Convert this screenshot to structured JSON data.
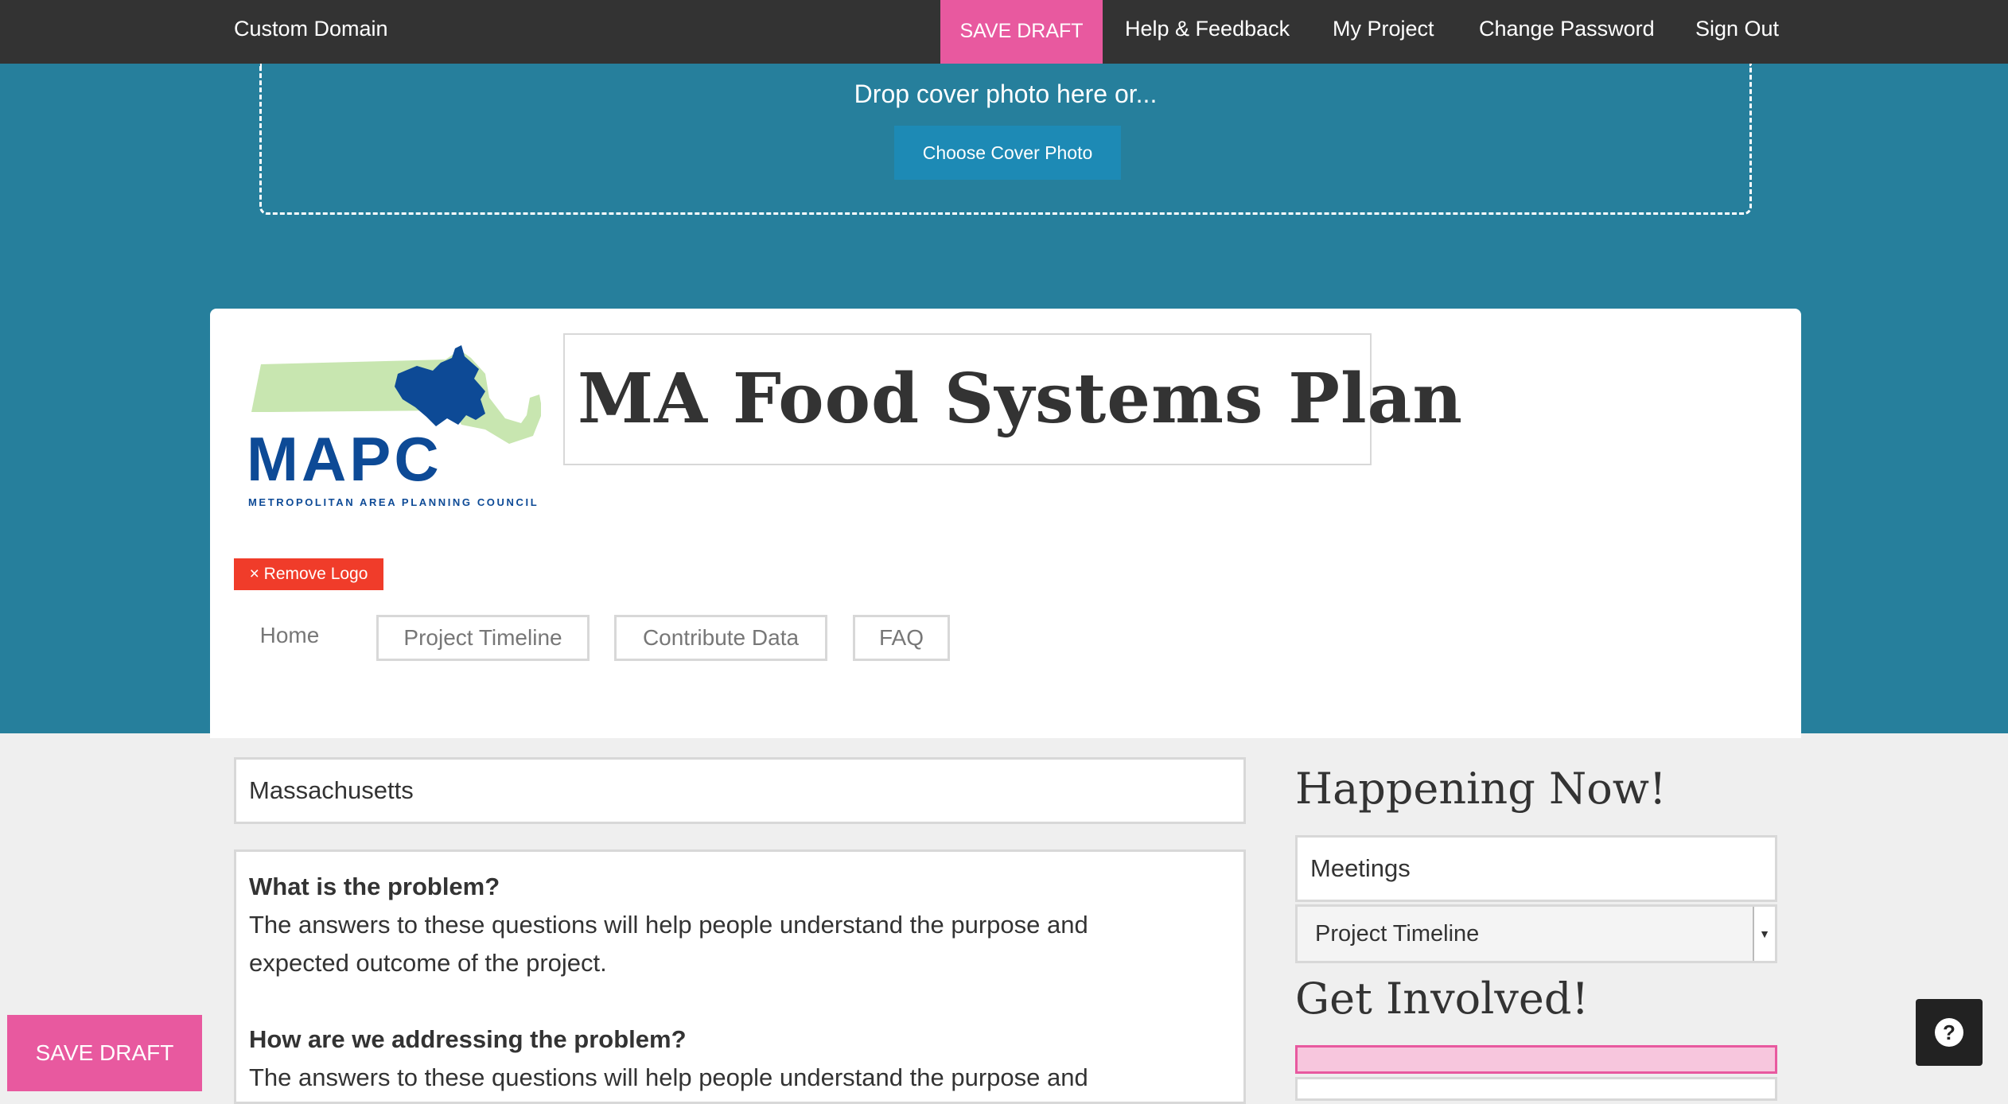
{
  "topbar": {
    "custom_domain": "Custom Domain",
    "save_draft": "SAVE DRAFT",
    "help_feedback": "Help & Feedback",
    "my_project": "My Project",
    "change_password": "Change Password",
    "sign_out": "Sign Out"
  },
  "cover": {
    "drop_text": "Drop cover photo here or...",
    "choose_button": "Choose Cover Photo"
  },
  "header": {
    "logo_text": "MAPC",
    "logo_subtitle": "METROPOLITAN AREA PLANNING COUNCIL",
    "title": "MA Food Systems Plan",
    "remove_logo": "× Remove Logo"
  },
  "tabs": [
    {
      "label": "Home"
    },
    {
      "label": "Project Timeline"
    },
    {
      "label": "Contribute Data"
    },
    {
      "label": "FAQ"
    }
  ],
  "main": {
    "location": "Massachusetts",
    "sections": [
      {
        "question": "What is the problem?",
        "answer_line1": "The answers to these questions will help people understand the purpose and",
        "answer_line2": "expected outcome of the project."
      },
      {
        "question": "How are we addressing the problem?",
        "answer_line1": "The answers to these questions will help people understand the purpose and"
      }
    ]
  },
  "sidebar": {
    "happening_heading": "Happening Now!",
    "meetings_value": "Meetings",
    "timeline_select": "Project Timeline",
    "involved_heading": "Get Involved!"
  },
  "footer": {
    "save_draft": "SAVE DRAFT"
  },
  "colors": {
    "topbar": "#333333",
    "hero": "#267f9c",
    "accent_pink": "#e8599f",
    "button_blue": "#1d8ab5",
    "remove_red": "#f03c2a",
    "logo_green": "#c8e6b0",
    "logo_blue": "#0d4a96"
  },
  "icons": {
    "help": "question-circle-icon",
    "select_arrow": "caret-down-icon"
  }
}
